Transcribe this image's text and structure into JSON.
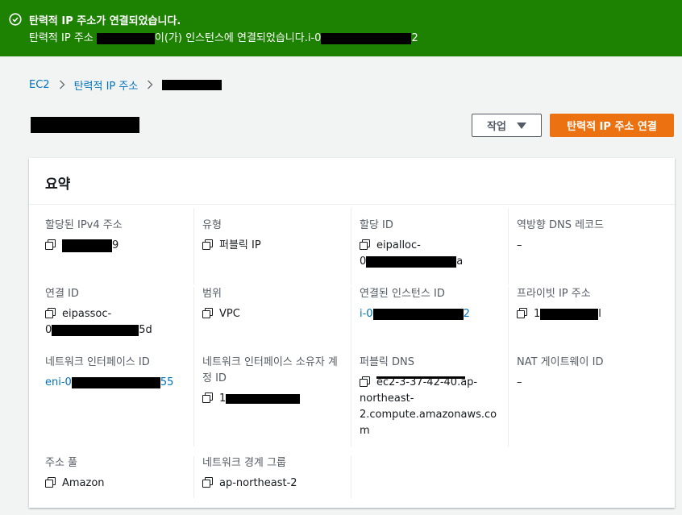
{
  "flash": {
    "title": "탄력적 IP 주소가 연결되었습니다.",
    "msg_prefix": "탄력적 IP 주소 ",
    "msg_middle": "이(가) 인스턴스에 연결되었습니다.i-0",
    "msg_suffix": "2",
    "color": "#1d8102"
  },
  "breadcrumb": {
    "items": [
      "EC2",
      "탄력적 IP 주소"
    ]
  },
  "header": {
    "actions_label": "작업",
    "primary_label": "탄력적 IP 주소 연결",
    "primary_color": "#ec7211"
  },
  "summary": {
    "title": "요약",
    "allocated_ipv4_label": "할당된 IPv4 주소",
    "allocated_ipv4_suffix": "9",
    "type_label": "유형",
    "type_value": "퍼블릭 IP",
    "allocation_id_label": "할당 ID",
    "allocation_id_line1": "eipalloc-",
    "allocation_id_prefix": "0",
    "allocation_id_suffix": "a",
    "reverse_dns_label": "역방향 DNS 레코드",
    "reverse_dns_value": "–",
    "association_id_label": "연결 ID",
    "association_id_line1": "eipassoc-",
    "association_id_prefix": "0",
    "association_id_suffix": "5d",
    "scope_label": "범위",
    "scope_value": "VPC",
    "instance_label": "연결된 인스턴스 ID",
    "instance_prefix": "i-0",
    "instance_suffix": "2",
    "private_ip_label": "프라이빗 IP 주소",
    "private_ip_prefix": "1",
    "private_ip_suffix": "l",
    "eni_label": "네트워크 인터페이스 ID",
    "eni_prefix": "eni-0",
    "eni_suffix": "55",
    "owner_label_line1": "네트워크 인터페이스 소유자 계",
    "owner_label_line2": "정 ID",
    "owner_prefix": "1",
    "public_dns_label": "퍼블릭 DNS",
    "public_dns_line1": "ec2-3-37-42-40.ap-",
    "public_dns_line2": "northeast-",
    "public_dns_line3": "2.compute.amazonaws.co",
    "public_dns_line4": "m",
    "nat_label": "NAT 게이트웨이 ID",
    "nat_value": "–",
    "pool_label": "주소 풀",
    "pool_value": "Amazon",
    "border_group_label": "네트워크 경계 그룹",
    "border_group_value": "ap-northeast-2"
  }
}
